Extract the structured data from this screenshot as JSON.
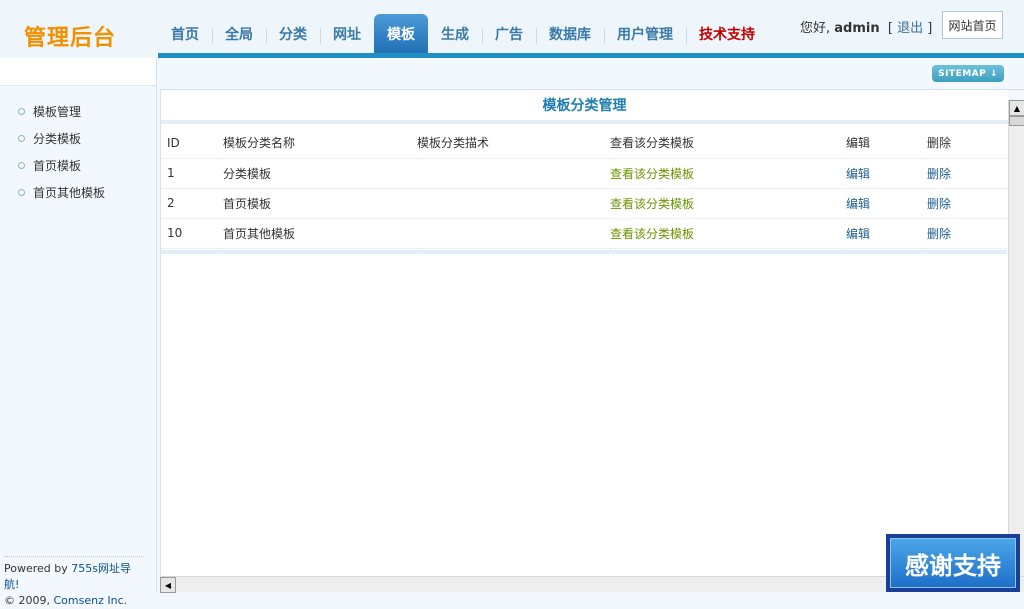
{
  "header": {
    "logo": "管理后台",
    "nav": [
      "首页",
      "全局",
      "分类",
      "网址",
      "模板",
      "生成",
      "广告",
      "数据库",
      "用户管理",
      "技术支持"
    ],
    "active_index": 4,
    "greeting": "您好,",
    "username": "admin",
    "logout": "退出",
    "site_home": "网站首页"
  },
  "toolbar": {
    "sitemap": "SITEMAP ↓"
  },
  "sidebar": {
    "items": [
      "模板管理",
      "分类模板",
      "首页模板",
      "首页其他模板"
    ],
    "powered_prefix": "Powered by ",
    "powered_link": "755s网址导航!",
    "copyright_prefix": "© 2009, ",
    "copyright_link": "Comsenz Inc."
  },
  "content": {
    "title": "模板分类管理",
    "columns": [
      "ID",
      "模板分类名称",
      "模板分类描术",
      "查看该分类模板",
      "编辑",
      "删除"
    ],
    "rows": [
      {
        "id": "1",
        "name": "分类模板",
        "desc": "",
        "view": "查看该分类模板",
        "edit": "编辑",
        "delete": "删除"
      },
      {
        "id": "2",
        "name": "首页模板",
        "desc": "",
        "view": "查看该分类模板",
        "edit": "编辑",
        "delete": "删除"
      },
      {
        "id": "10",
        "name": "首页其他模板",
        "desc": "",
        "view": "查看该分类模板",
        "edit": "编辑",
        "delete": "删除"
      }
    ]
  },
  "overlay": {
    "thanks": "感谢支持"
  },
  "colors": {
    "accent": "#1f8fc4",
    "logo": "#f29000",
    "link_green": "#6b9400",
    "nav_red": "#c00000"
  },
  "icons": {
    "scroll_up": "▲",
    "scroll_left": "◀"
  }
}
